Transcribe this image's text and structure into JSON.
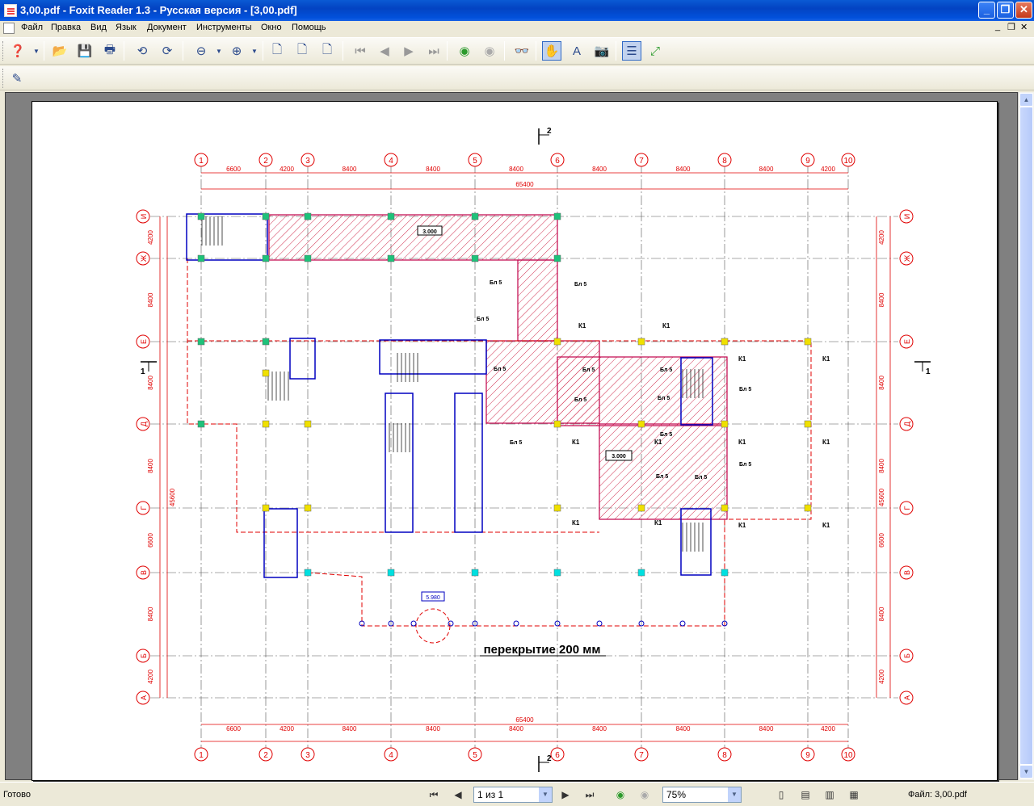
{
  "window": {
    "title": "3,00.pdf - Foxit Reader 1.3 - Русская версия  - [3,00.pdf]"
  },
  "menu": [
    "Файл",
    "Правка",
    "Вид",
    "Язык",
    "Документ",
    "Инструменты",
    "Окно",
    "Помощь"
  ],
  "status": {
    "text": "Готово",
    "page_combo": "1 из 1",
    "zoom": "75%",
    "file": "Файл: 3,00.pdf"
  },
  "drawing": {
    "section_mark": "2",
    "section_mark_side": "1",
    "axis_top": [
      "1",
      "2",
      "3",
      "4",
      "5",
      "6",
      "7",
      "8",
      "9",
      "10"
    ],
    "axis_left": [
      "И",
      "Ж",
      "Е",
      "Д",
      "Г",
      "В",
      "Б",
      "А"
    ],
    "dims_top": [
      "6600",
      "4200",
      "8400",
      "8400",
      "8400",
      "8400",
      "8400",
      "8400",
      "4200"
    ],
    "dims_total": "65400",
    "dims_left": [
      "4200",
      "8400",
      "8400",
      "8400",
      "6600",
      "8400",
      "4200"
    ],
    "dims_left_total": "45600",
    "elev_1": "3.000",
    "elev_2": "3.000",
    "elev_3": "5.980",
    "beam_label": "Бл 5",
    "col_label": "К1",
    "caption": "перекрытие 200 мм"
  },
  "colors": {
    "accent": "#0054e3",
    "dim": "#e00000",
    "plan": "#c0004a",
    "wall": "#0000c0"
  }
}
